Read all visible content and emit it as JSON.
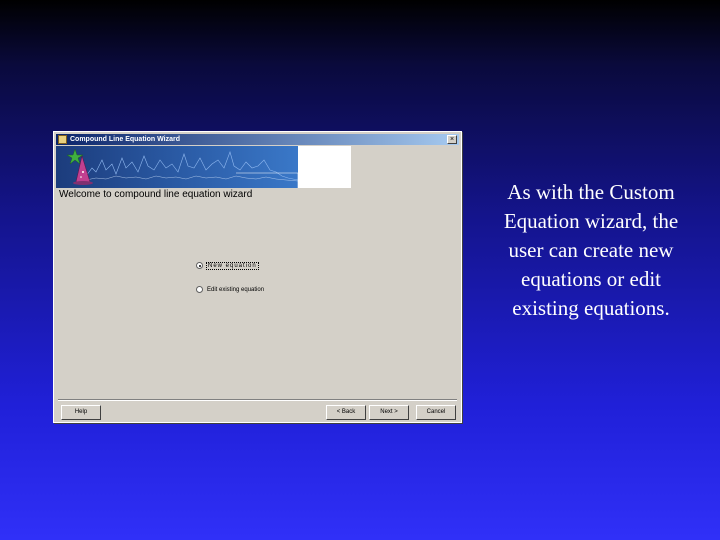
{
  "caption": "As with the Custom Equation wizard, the user can create new equations or edit existing equations.",
  "window": {
    "title": "Compound Line Equation Wizard",
    "close_label": "×",
    "heading": "Welcome to compound line equation wizard",
    "options": [
      {
        "label": "New equation",
        "selected": true
      },
      {
        "label": "Edit existing equation",
        "selected": false
      }
    ],
    "buttons": {
      "help": "Help",
      "back": "< Back",
      "next": "Next >",
      "cancel": "Cancel"
    }
  }
}
